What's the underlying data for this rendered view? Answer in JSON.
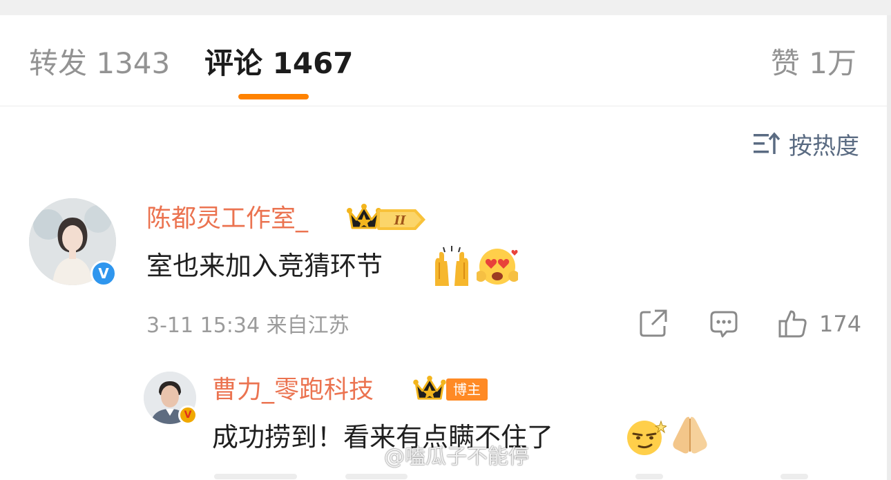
{
  "tabs": {
    "repost": "转发 1343",
    "comment": "评论 1467",
    "like": "赞 1万"
  },
  "sort": {
    "label": "按热度"
  },
  "comments": [
    {
      "author": "陈都灵工作室_",
      "verified": "blue-v",
      "fan_level_badge": "II",
      "text": "室也来加入竞猜环节",
      "emojis": [
        "raised-hands-emoji",
        "heart-eyes-emoji"
      ],
      "meta": "3-11 15:34  来自江苏",
      "likes": "174",
      "reply": {
        "author": "曹力_零跑科技",
        "verified": "gold-v",
        "role_badge": "博主",
        "text": "成功捞到！看来有点瞒不住了",
        "emojis": [
          "smirk-emoji",
          "pray-hands-emoji"
        ]
      }
    }
  ],
  "watermark": {
    "text": "@嗑瓜子不能停"
  },
  "colors": {
    "accent": "#ff8200",
    "author_name": "#eb7350",
    "sort_text": "#5a6b82",
    "muted": "#9b9b9b",
    "verified_blue": "#2f96ee",
    "verified_gold": "#f0a800"
  }
}
